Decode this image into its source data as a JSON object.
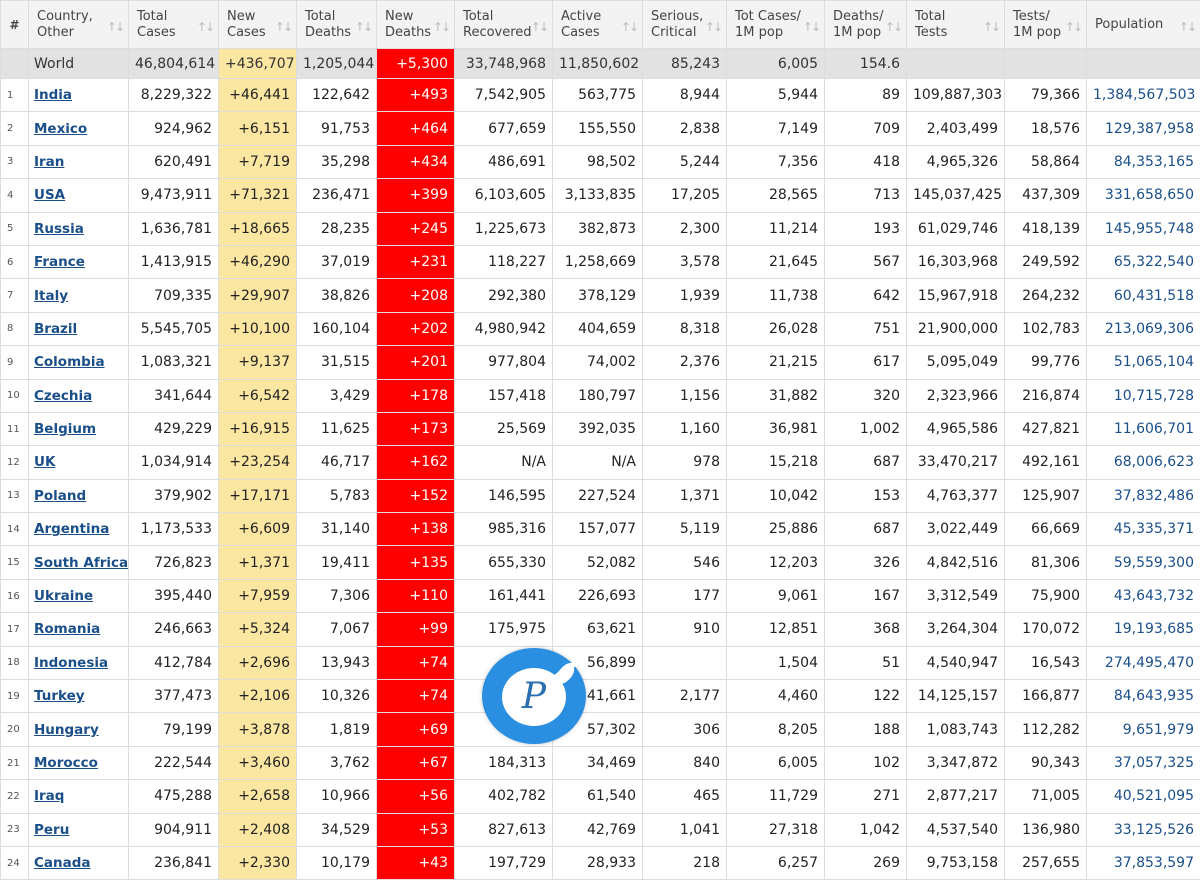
{
  "headers": [
    {
      "label_1": "#",
      "label_2": ""
    },
    {
      "label_1": "Country,",
      "label_2": "Other"
    },
    {
      "label_1": "Total",
      "label_2": "Cases"
    },
    {
      "label_1": "New",
      "label_2": "Cases"
    },
    {
      "label_1": "Total",
      "label_2": "Deaths"
    },
    {
      "label_1": "New",
      "label_2": "Deaths"
    },
    {
      "label_1": "Total",
      "label_2": "Recovered"
    },
    {
      "label_1": "Active",
      "label_2": "Cases"
    },
    {
      "label_1": "Serious,",
      "label_2": "Critical"
    },
    {
      "label_1": "Tot Cases/",
      "label_2": "1M pop"
    },
    {
      "label_1": "Deaths/",
      "label_2": "1M pop"
    },
    {
      "label_1": "Total",
      "label_2": "Tests"
    },
    {
      "label_1": "Tests/",
      "label_2": "1M pop"
    },
    {
      "label_1": "Population",
      "label_2": ""
    }
  ],
  "world": [
    "",
    "World",
    "46,804,614",
    "+436,707",
    "1,205,044",
    "+5,300",
    "33,748,968",
    "11,850,602",
    "85,243",
    "6,005",
    "154.6",
    "",
    "",
    ""
  ],
  "rows": [
    [
      "1",
      "India",
      "8,229,322",
      "+46,441",
      "122,642",
      "+493",
      "7,542,905",
      "563,775",
      "8,944",
      "5,944",
      "89",
      "109,887,303",
      "79,366",
      "1,384,567,503"
    ],
    [
      "2",
      "Mexico",
      "924,962",
      "+6,151",
      "91,753",
      "+464",
      "677,659",
      "155,550",
      "2,838",
      "7,149",
      "709",
      "2,403,499",
      "18,576",
      "129,387,958"
    ],
    [
      "3",
      "Iran",
      "620,491",
      "+7,719",
      "35,298",
      "+434",
      "486,691",
      "98,502",
      "5,244",
      "7,356",
      "418",
      "4,965,326",
      "58,864",
      "84,353,165"
    ],
    [
      "4",
      "USA",
      "9,473,911",
      "+71,321",
      "236,471",
      "+399",
      "6,103,605",
      "3,133,835",
      "17,205",
      "28,565",
      "713",
      "145,037,425",
      "437,309",
      "331,658,650"
    ],
    [
      "5",
      "Russia",
      "1,636,781",
      "+18,665",
      "28,235",
      "+245",
      "1,225,673",
      "382,873",
      "2,300",
      "11,214",
      "193",
      "61,029,746",
      "418,139",
      "145,955,748"
    ],
    [
      "6",
      "France",
      "1,413,915",
      "+46,290",
      "37,019",
      "+231",
      "118,227",
      "1,258,669",
      "3,578",
      "21,645",
      "567",
      "16,303,968",
      "249,592",
      "65,322,540"
    ],
    [
      "7",
      "Italy",
      "709,335",
      "+29,907",
      "38,826",
      "+208",
      "292,380",
      "378,129",
      "1,939",
      "11,738",
      "642",
      "15,967,918",
      "264,232",
      "60,431,518"
    ],
    [
      "8",
      "Brazil",
      "5,545,705",
      "+10,100",
      "160,104",
      "+202",
      "4,980,942",
      "404,659",
      "8,318",
      "26,028",
      "751",
      "21,900,000",
      "102,783",
      "213,069,306"
    ],
    [
      "9",
      "Colombia",
      "1,083,321",
      "+9,137",
      "31,515",
      "+201",
      "977,804",
      "74,002",
      "2,376",
      "21,215",
      "617",
      "5,095,049",
      "99,776",
      "51,065,104"
    ],
    [
      "10",
      "Czechia",
      "341,644",
      "+6,542",
      "3,429",
      "+178",
      "157,418",
      "180,797",
      "1,156",
      "31,882",
      "320",
      "2,323,966",
      "216,874",
      "10,715,728"
    ],
    [
      "11",
      "Belgium",
      "429,229",
      "+16,915",
      "11,625",
      "+173",
      "25,569",
      "392,035",
      "1,160",
      "36,981",
      "1,002",
      "4,965,586",
      "427,821",
      "11,606,701"
    ],
    [
      "12",
      "UK",
      "1,034,914",
      "+23,254",
      "46,717",
      "+162",
      "N/A",
      "N/A",
      "978",
      "15,218",
      "687",
      "33,470,217",
      "492,161",
      "68,006,623"
    ],
    [
      "13",
      "Poland",
      "379,902",
      "+17,171",
      "5,783",
      "+152",
      "146,595",
      "227,524",
      "1,371",
      "10,042",
      "153",
      "4,763,377",
      "125,907",
      "37,832,486"
    ],
    [
      "14",
      "Argentina",
      "1,173,533",
      "+6,609",
      "31,140",
      "+138",
      "985,316",
      "157,077",
      "5,119",
      "25,886",
      "687",
      "3,022,449",
      "66,669",
      "45,335,371"
    ],
    [
      "15",
      "South Africa",
      "726,823",
      "+1,371",
      "19,411",
      "+135",
      "655,330",
      "52,082",
      "546",
      "12,203",
      "326",
      "4,842,516",
      "81,306",
      "59,559,300"
    ],
    [
      "16",
      "Ukraine",
      "395,440",
      "+7,959",
      "7,306",
      "+110",
      "161,441",
      "226,693",
      "177",
      "9,061",
      "167",
      "3,312,549",
      "75,900",
      "43,643,732"
    ],
    [
      "17",
      "Romania",
      "246,663",
      "+5,324",
      "7,067",
      "+99",
      "175,975",
      "63,621",
      "910",
      "12,851",
      "368",
      "3,264,304",
      "170,072",
      "19,193,685"
    ],
    [
      "18",
      "Indonesia",
      "412,784",
      "+2,696",
      "13,943",
      "+74",
      "",
      "56,899",
      "",
      "1,504",
      "51",
      "4,540,947",
      "16,543",
      "274,495,470"
    ],
    [
      "19",
      "Turkey",
      "377,473",
      "+2,106",
      "10,326",
      "+74",
      "",
      "41,661",
      "2,177",
      "4,460",
      "122",
      "14,125,157",
      "166,877",
      "84,643,935"
    ],
    [
      "20",
      "Hungary",
      "79,199",
      "+3,878",
      "1,819",
      "+69",
      "",
      "57,302",
      "306",
      "8,205",
      "188",
      "1,083,743",
      "112,282",
      "9,651,979"
    ],
    [
      "21",
      "Morocco",
      "222,544",
      "+3,460",
      "3,762",
      "+67",
      "184,313",
      "34,469",
      "840",
      "6,005",
      "102",
      "3,347,872",
      "90,343",
      "37,057,325"
    ],
    [
      "22",
      "Iraq",
      "475,288",
      "+2,658",
      "10,966",
      "+56",
      "402,782",
      "61,540",
      "465",
      "11,729",
      "271",
      "2,877,217",
      "71,005",
      "40,521,095"
    ],
    [
      "23",
      "Peru",
      "904,911",
      "+2,408",
      "34,529",
      "+53",
      "827,613",
      "42,769",
      "1,041",
      "27,318",
      "1,042",
      "4,537,540",
      "136,980",
      "33,125,526"
    ],
    [
      "24",
      "Canada",
      "236,841",
      "+2,330",
      "10,179",
      "+43",
      "197,729",
      "28,933",
      "218",
      "6,257",
      "269",
      "9,753,158",
      "257,655",
      "37,853,597"
    ]
  ],
  "colors": {
    "new_cases_bg": "#fbe6a2",
    "new_deaths_bg": "#ff0000",
    "link": "#1a4f8a",
    "world_bg": "#e2e2e2",
    "watermark": "#2a8fe0"
  },
  "watermark": {
    "icon": "bird-logo-icon",
    "letter": "P"
  }
}
